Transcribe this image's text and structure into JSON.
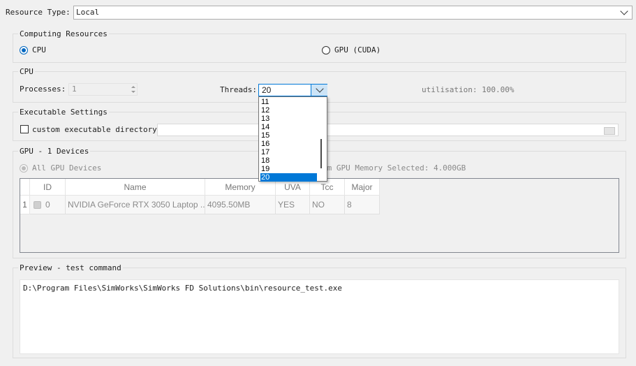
{
  "resource_type": {
    "label": "Resource Type:",
    "value": "Local"
  },
  "computing_resources": {
    "title": "Computing Resources",
    "cpu_label": "CPU",
    "gpu_label": "GPU (CUDA)",
    "selected": "CPU"
  },
  "cpu": {
    "title": "CPU",
    "processes_label": "Processes:",
    "processes_value": "1",
    "threads_label": "Threads:",
    "threads_value": "20",
    "utilisation_text": "utilisation: 100.00%"
  },
  "threads_dropdown": {
    "options": [
      "11",
      "12",
      "13",
      "14",
      "15",
      "16",
      "17",
      "18",
      "19",
      "20"
    ],
    "selected": "20"
  },
  "executable": {
    "title": "Executable Settings",
    "custom_dir_label": "custom executable directory:",
    "custom_dir_checked": false,
    "dir_value": ""
  },
  "gpu": {
    "title": "GPU - 1 Devices",
    "all_devices_label": "All GPU Devices",
    "memory_text": "um GPU Memory Selected: 4.000GB",
    "columns": [
      "ID",
      "Name",
      "Memory",
      "UVA",
      "Tcc",
      "Major"
    ],
    "rows": [
      {
        "row_num": "1",
        "id": "0",
        "name": "NVIDIA GeForce RTX 3050 Laptop ...",
        "memory": "4095.50MB",
        "uva": "YES",
        "tcc": "NO",
        "major": "8"
      }
    ]
  },
  "preview": {
    "title": "Preview - test command",
    "command": "D:\\Program Files\\SimWorks\\SimWorks FD Solutions\\bin\\resource_test.exe"
  },
  "colors": {
    "accent": "#0078d7",
    "radio_on": "#0067c0"
  }
}
